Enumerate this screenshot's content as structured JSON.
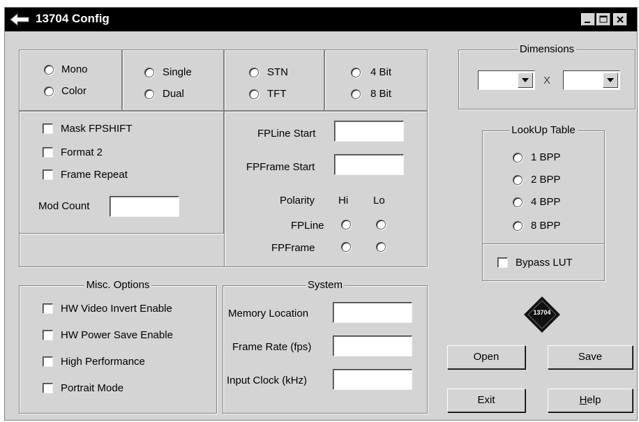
{
  "window": {
    "title": "13704 Config"
  },
  "display_type": {
    "mono": "Mono",
    "color": "Color"
  },
  "scan": {
    "single": "Single",
    "dual": "Dual"
  },
  "panel": {
    "stn": "STN",
    "tft": "TFT"
  },
  "bits": {
    "four": "4 Bit",
    "eight": "8 Bit"
  },
  "options": {
    "mask_fpshift": "Mask FPSHIFT",
    "format2": "Format 2",
    "frame_repeat": "Frame Repeat",
    "mod_count": "Mod Count"
  },
  "fp": {
    "line_start": "FPLine Start",
    "frame_start": "FPFrame Start",
    "polarity": "Polarity",
    "hi": "Hi",
    "lo": "Lo",
    "fpline": "FPLine",
    "fpframe": "FPFrame"
  },
  "dimensions": {
    "legend": "Dimensions",
    "x": "X"
  },
  "lut": {
    "legend": "LookUp Table",
    "bpp1": "1 BPP",
    "bpp2": "2 BPP",
    "bpp4": "4 BPP",
    "bpp8": "8 BPP",
    "bypass": "Bypass LUT"
  },
  "logo": {
    "text": "13704"
  },
  "misc": {
    "legend": "Misc. Options",
    "hw_video": "HW Video Invert Enable",
    "hw_power": "HW Power Save Enable",
    "high_perf": "High Performance",
    "portrait": "Portrait Mode"
  },
  "system": {
    "legend": "System",
    "memory": "Memory Location",
    "frame_rate": "Frame Rate (fps)",
    "input_clock": "Input Clock (kHz)"
  },
  "buttons": {
    "open": "Open",
    "save": "Save",
    "exit": "Exit",
    "help_first": "H",
    "help_rest": "elp"
  },
  "colors": {
    "titlebar": "#000000",
    "face": "#d4d4d4"
  }
}
